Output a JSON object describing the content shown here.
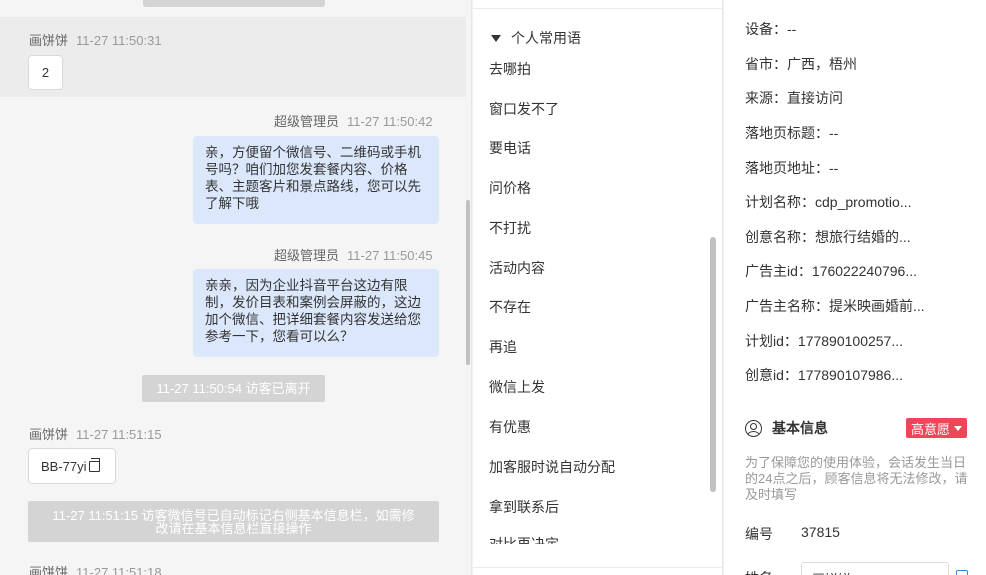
{
  "chat": {
    "messages": [
      {
        "sender": "画饼饼",
        "time": "11-27 11:50:31",
        "text": "2"
      },
      {
        "sender": "超级管理员",
        "time": "11-27 11:50:42",
        "text": "亲，方便留个微信号、二维码或手机号吗？咱们加您发套餐内容、价格表、主题客片和景点路线，您可以先了解下哦"
      },
      {
        "sender": "超级管理员",
        "time": "11-27 11:50:45",
        "text": "亲亲，因为企业抖音平台这边有限制，发价目表和案例会屏蔽的，这边加个微信、把详细套餐内容发送给您参考一下，您看可以么？"
      },
      {
        "system": "11-27 11:50:54 访客已离开"
      },
      {
        "sender": "画饼饼",
        "time": "11-27 11:51:15",
        "text": "BB-77yi"
      },
      {
        "system": "11-27 11:51:15 访客微信号已自动标记右侧基本信息栏，如需修改请在基本信息栏直接操作"
      },
      {
        "sender": "画饼饼",
        "time": "11-27 11:51:18"
      }
    ],
    "system_msg_1": "11-27 11:50:54 访客已离开",
    "system_msg_2_line1": "11-27 11:51:15 访客微信号已自动标记右侧基本信息栏，如需修",
    "system_msg_2_line2": "改请在基本信息栏直接操作"
  },
  "phrases": {
    "group_title": "个人常用语",
    "items": [
      "去哪拍",
      "窗口发不了",
      "要电话",
      "问价格",
      "不打扰",
      "活动内容",
      "不存在",
      "再追",
      "微信上发",
      "有优惠",
      "加客服时说自动分配",
      "拿到联系后",
      "对比再决定"
    ]
  },
  "info": {
    "rows": [
      {
        "label": "设备：",
        "value": "--"
      },
      {
        "label": "省市：",
        "value": "广西，梧州"
      },
      {
        "label": "来源：",
        "value": "直接访问"
      },
      {
        "label": "落地页标题：",
        "value": "--"
      },
      {
        "label": "落地页地址：",
        "value": "--"
      },
      {
        "label": "计划名称：",
        "value": "cdp_promotio..."
      },
      {
        "label": "创意名称：",
        "value": "想旅行结婚的..."
      },
      {
        "label": "广告主id：",
        "value": "176022240796..."
      },
      {
        "label": "广告主名称：",
        "value": "提米映画婚前..."
      },
      {
        "label": "计划id：",
        "value": "177890100257..."
      },
      {
        "label": "创意id：",
        "value": "177890107986..."
      }
    ],
    "basic_title": "基本信息",
    "intent_badge": "高意愿",
    "notice": "为了保障您的使用体验，会话发生当日的24点之后，顾客信息将无法修改，请及时填写",
    "id_label": "编号",
    "id_value": "37815",
    "name_label": "姓名",
    "name_value": "画饼饼"
  },
  "colors": {
    "badge": "#f0465a",
    "bubble_blue": "#dbe8fc",
    "system_msg": "#d4d4d4"
  }
}
